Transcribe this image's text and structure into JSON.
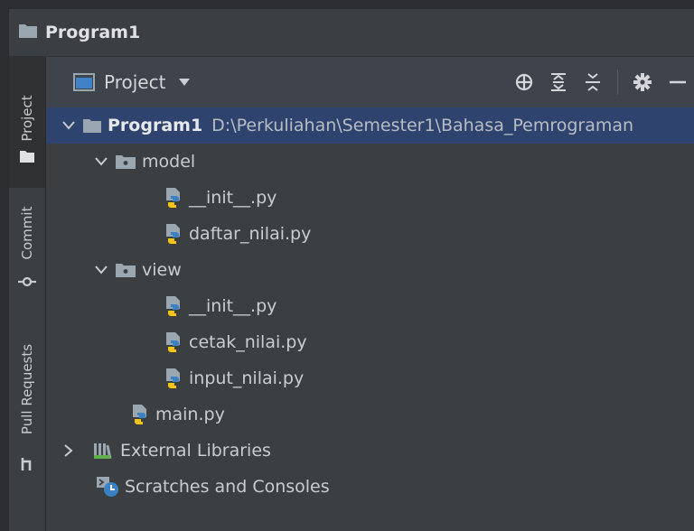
{
  "window": {
    "title": "Program1"
  },
  "sidebar": {
    "tabs": [
      {
        "label": "Project"
      },
      {
        "label": "Commit"
      },
      {
        "label": "Pull Requests"
      }
    ]
  },
  "toolbar": {
    "view_selector": "Project"
  },
  "tree": {
    "root": {
      "name": "Program1",
      "path": "D:\\Perkuliahan\\Semester1\\Bahasa_Pemrograman"
    },
    "model": {
      "name": "model",
      "children": [
        "__init__.py",
        "daftar_nilai.py"
      ]
    },
    "view": {
      "name": "view",
      "children": [
        "__init__.py",
        "cetak_nilai.py",
        "input_nilai.py"
      ]
    },
    "main": "main.py",
    "external": "External Libraries",
    "scratches": "Scratches and Consoles"
  },
  "colors": {
    "background": "#3c3f41",
    "toolbar": "#3e434c",
    "selection": "#2e436e",
    "folder": "#9aa7b0",
    "python_blue": "#3b82c4",
    "python_yellow": "#f2c418"
  }
}
